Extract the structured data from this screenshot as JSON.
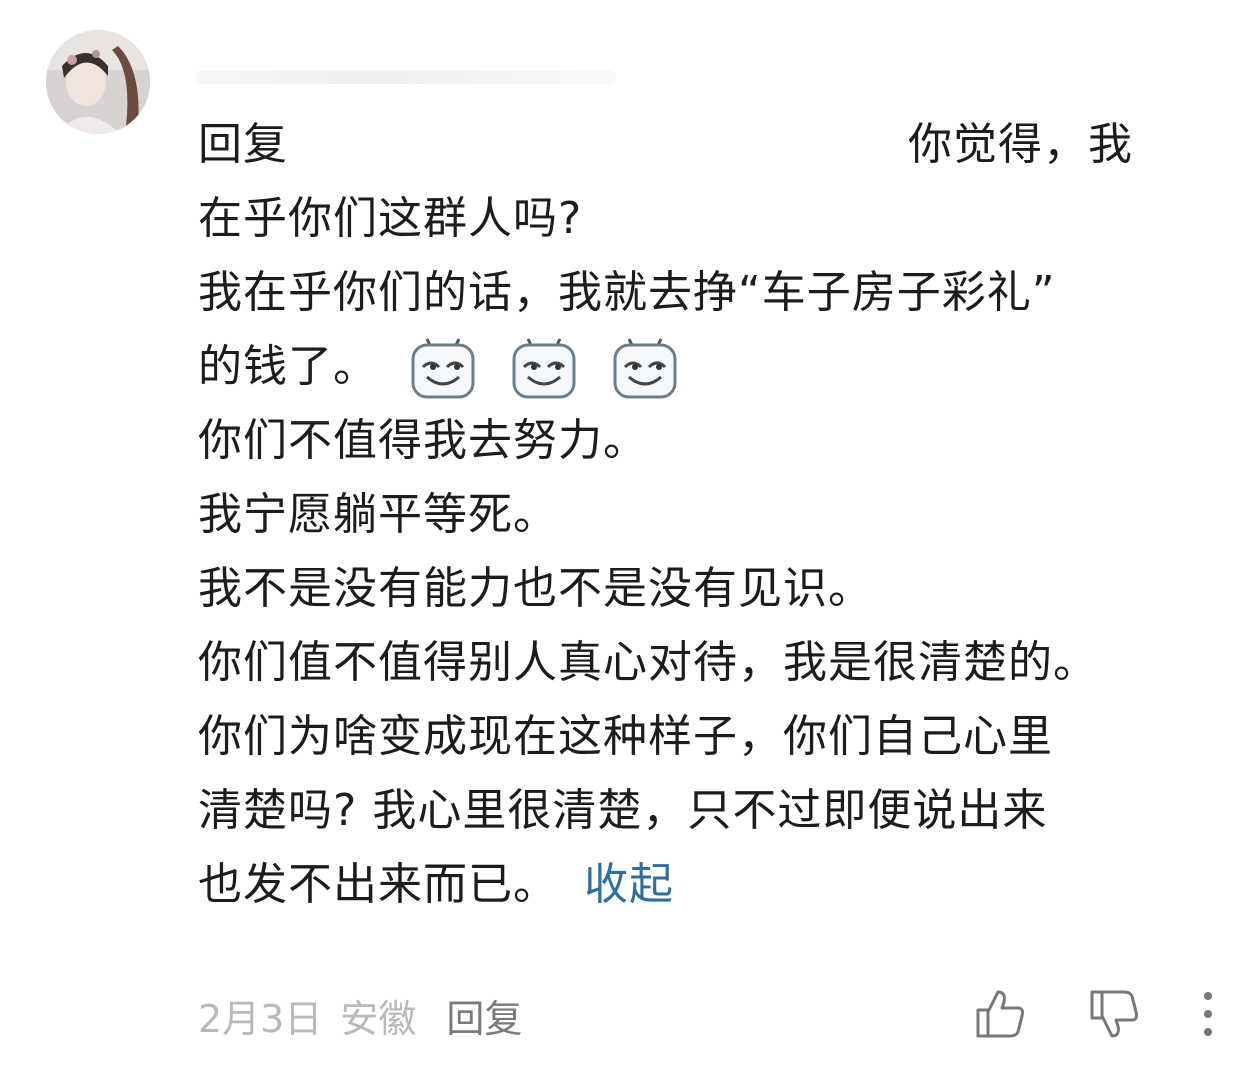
{
  "comment": {
    "lines": [
      {
        "text": "回复",
        "right": "你觉得，我"
      },
      {
        "text": "在乎你们这群人吗?"
      },
      {
        "text": "我在乎你们的话，我就去挣“车子房子彩礼”"
      },
      {
        "text": "的钱了。"
      },
      {
        "text": "你们不值得我去努力。"
      },
      {
        "text": "我宁愿躺平等死。"
      },
      {
        "text": "我不是没有能力也不是没有见识。"
      },
      {
        "text": "你们值不值得别人真心对待，我是很清楚的。"
      },
      {
        "text": "你们为啥变成现在这种样子，你们自己心里"
      },
      {
        "text": "清楚吗? 我心里很清楚，只不过即便说出来"
      },
      {
        "text": "也发不出来而已。"
      }
    ],
    "collapse_label": "收起",
    "emoji_icons": [
      "grin-emoji-icon",
      "grin-emoji-icon",
      "grin-emoji-icon"
    ]
  },
  "footer": {
    "date": "2月3日",
    "location": "安徽",
    "reply_label": "回复"
  },
  "colors": {
    "text": "#1c1c1c",
    "link": "#2f6fa0",
    "meta": "#b9b9b9",
    "icon": "#777777"
  }
}
